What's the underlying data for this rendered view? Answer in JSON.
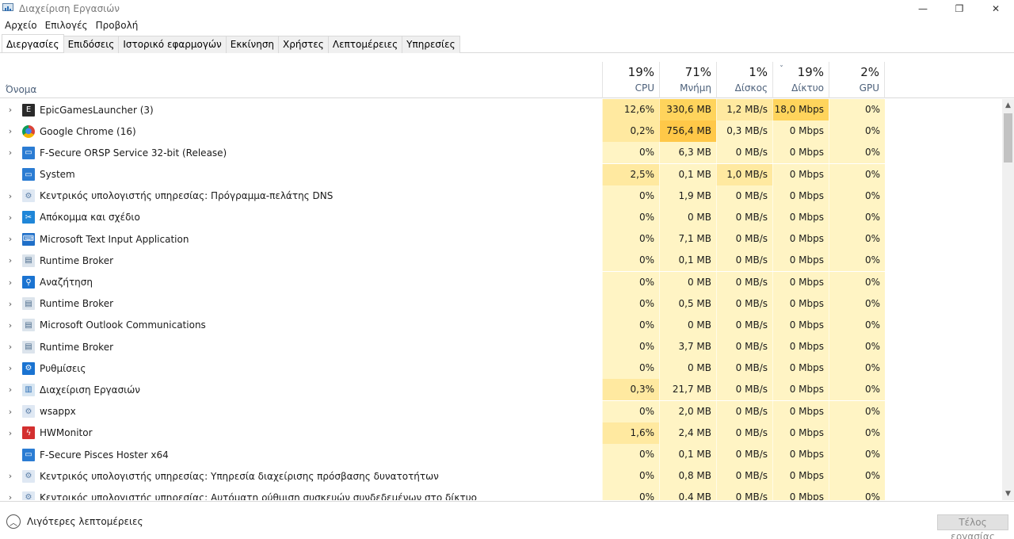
{
  "window": {
    "title": "Διαχείριση Εργασιών",
    "controls": {
      "minimize": "—",
      "restore": "❐",
      "close": "✕"
    }
  },
  "menu": [
    "Αρχείο",
    "Επιλογές",
    "Προβολή"
  ],
  "tabs": [
    {
      "label": "Διεργασίες",
      "active": true
    },
    {
      "label": "Επιδόσεις",
      "active": false
    },
    {
      "label": "Ιστορικό εφαρμογών",
      "active": false
    },
    {
      "label": "Εκκίνηση",
      "active": false
    },
    {
      "label": "Χρήστες",
      "active": false
    },
    {
      "label": "Λεπτομέρειες",
      "active": false
    },
    {
      "label": "Υπηρεσίες",
      "active": false
    }
  ],
  "header": {
    "name_label": "Όνομα",
    "columns": [
      {
        "key": "cpu",
        "percent": "19%",
        "label": "CPU"
      },
      {
        "key": "mem",
        "percent": "71%",
        "label": "Μνήμη"
      },
      {
        "key": "disk",
        "percent": "1%",
        "label": "Δίσκος"
      },
      {
        "key": "net",
        "percent": "19%",
        "label": "Δίκτυο",
        "sorted": true,
        "sort_glyph": "ˇ"
      },
      {
        "key": "gpu",
        "percent": "2%",
        "label": "GPU"
      }
    ]
  },
  "processes": [
    {
      "name": "EpicGamesLauncher (3)",
      "icon": "epic-games-icon",
      "expandable": true,
      "cpu": "12,6%",
      "mem": "330,6 MB",
      "disk": "1,2 MB/s",
      "net": "18,0 Mbps",
      "gpu": "0%"
    },
    {
      "name": "Google Chrome (16)",
      "icon": "chrome-icon",
      "expandable": true,
      "cpu": "0,2%",
      "mem": "756,4 MB",
      "disk": "0,3 MB/s",
      "net": "0 Mbps",
      "gpu": "0%"
    },
    {
      "name": "F-Secure ORSP Service 32-bit (Release)",
      "icon": "app-window-icon",
      "expandable": true,
      "cpu": "0%",
      "mem": "6,3 MB",
      "disk": "0 MB/s",
      "net": "0 Mbps",
      "gpu": "0%"
    },
    {
      "name": "System",
      "icon": "app-window-icon",
      "expandable": false,
      "cpu": "2,5%",
      "mem": "0,1 MB",
      "disk": "1,0 MB/s",
      "net": "0 Mbps",
      "gpu": "0%"
    },
    {
      "name": "Κεντρικός υπολογιστής υπηρεσίας: Πρόγραμμα-πελάτης DNS",
      "icon": "service-gear-icon",
      "expandable": true,
      "cpu": "0%",
      "mem": "1,9 MB",
      "disk": "0 MB/s",
      "net": "0 Mbps",
      "gpu": "0%"
    },
    {
      "name": "Απόκομμα και σχέδιο",
      "icon": "snip-sketch-icon",
      "expandable": true,
      "cpu": "0%",
      "mem": "0 MB",
      "disk": "0 MB/s",
      "net": "0 Mbps",
      "gpu": "0%"
    },
    {
      "name": "Microsoft Text Input Application",
      "icon": "text-input-icon",
      "expandable": true,
      "cpu": "0%",
      "mem": "7,1 MB",
      "disk": "0 MB/s",
      "net": "0 Mbps",
      "gpu": "0%"
    },
    {
      "name": "Runtime Broker",
      "icon": "runtime-broker-icon",
      "expandable": true,
      "cpu": "0%",
      "mem": "0,1 MB",
      "disk": "0 MB/s",
      "net": "0 Mbps",
      "gpu": "0%"
    },
    {
      "name": "Αναζήτηση",
      "icon": "search-icon",
      "expandable": true,
      "cpu": "0%",
      "mem": "0 MB",
      "disk": "0 MB/s",
      "net": "0 Mbps",
      "gpu": "0%"
    },
    {
      "name": "Runtime Broker",
      "icon": "runtime-broker-icon",
      "expandable": true,
      "cpu": "0%",
      "mem": "0,5 MB",
      "disk": "0 MB/s",
      "net": "0 Mbps",
      "gpu": "0%"
    },
    {
      "name": "Microsoft Outlook Communications",
      "icon": "runtime-broker-icon",
      "expandable": true,
      "cpu": "0%",
      "mem": "0 MB",
      "disk": "0 MB/s",
      "net": "0 Mbps",
      "gpu": "0%"
    },
    {
      "name": "Runtime Broker",
      "icon": "runtime-broker-icon",
      "expandable": true,
      "cpu": "0%",
      "mem": "3,7 MB",
      "disk": "0 MB/s",
      "net": "0 Mbps",
      "gpu": "0%"
    },
    {
      "name": "Ρυθμίσεις",
      "icon": "settings-gear-icon",
      "expandable": true,
      "cpu": "0%",
      "mem": "0 MB",
      "disk": "0 MB/s",
      "net": "0 Mbps",
      "gpu": "0%"
    },
    {
      "name": "Διαχείριση Εργασιών",
      "icon": "task-manager-icon",
      "expandable": true,
      "cpu": "0,3%",
      "mem": "21,7 MB",
      "disk": "0 MB/s",
      "net": "0 Mbps",
      "gpu": "0%"
    },
    {
      "name": "wsappx",
      "icon": "service-gear-icon",
      "expandable": true,
      "cpu": "0%",
      "mem": "2,0 MB",
      "disk": "0 MB/s",
      "net": "0 Mbps",
      "gpu": "0%"
    },
    {
      "name": "HWMonitor",
      "icon": "hwmonitor-icon",
      "expandable": true,
      "cpu": "1,6%",
      "mem": "2,4 MB",
      "disk": "0 MB/s",
      "net": "0 Mbps",
      "gpu": "0%"
    },
    {
      "name": "F-Secure Pisces Hoster x64",
      "icon": "app-window-icon",
      "expandable": false,
      "cpu": "0%",
      "mem": "0,1 MB",
      "disk": "0 MB/s",
      "net": "0 Mbps",
      "gpu": "0%"
    },
    {
      "name": "Κεντρικός υπολογιστής υπηρεσίας: Υπηρεσία διαχείρισης πρόσβασης δυνατοτήτων",
      "icon": "service-gear-icon",
      "expandable": true,
      "cpu": "0%",
      "mem": "0,8 MB",
      "disk": "0 MB/s",
      "net": "0 Mbps",
      "gpu": "0%"
    },
    {
      "name": "Κεντρικός υπολογιστής υπηρεσίας: Αυτόματη ρύθμιση συσκευών συνδεδεμένων στο δίκτυο",
      "icon": "service-gear-icon",
      "expandable": true,
      "cpu": "0%",
      "mem": "0,4 MB",
      "disk": "0 MB/s",
      "net": "0 Mbps",
      "gpu": "0%"
    }
  ],
  "footer": {
    "fewer_details": "Λιγότερες λεπτομέρειες",
    "end_task": "Τέλος εργασίας"
  },
  "colors": {
    "heat_low": "#fff4c4",
    "heat_mid": "#ffe9a0",
    "heat_high": "#ffd45c",
    "heat_hot": "#ffc848",
    "accent": "#0078d7"
  }
}
